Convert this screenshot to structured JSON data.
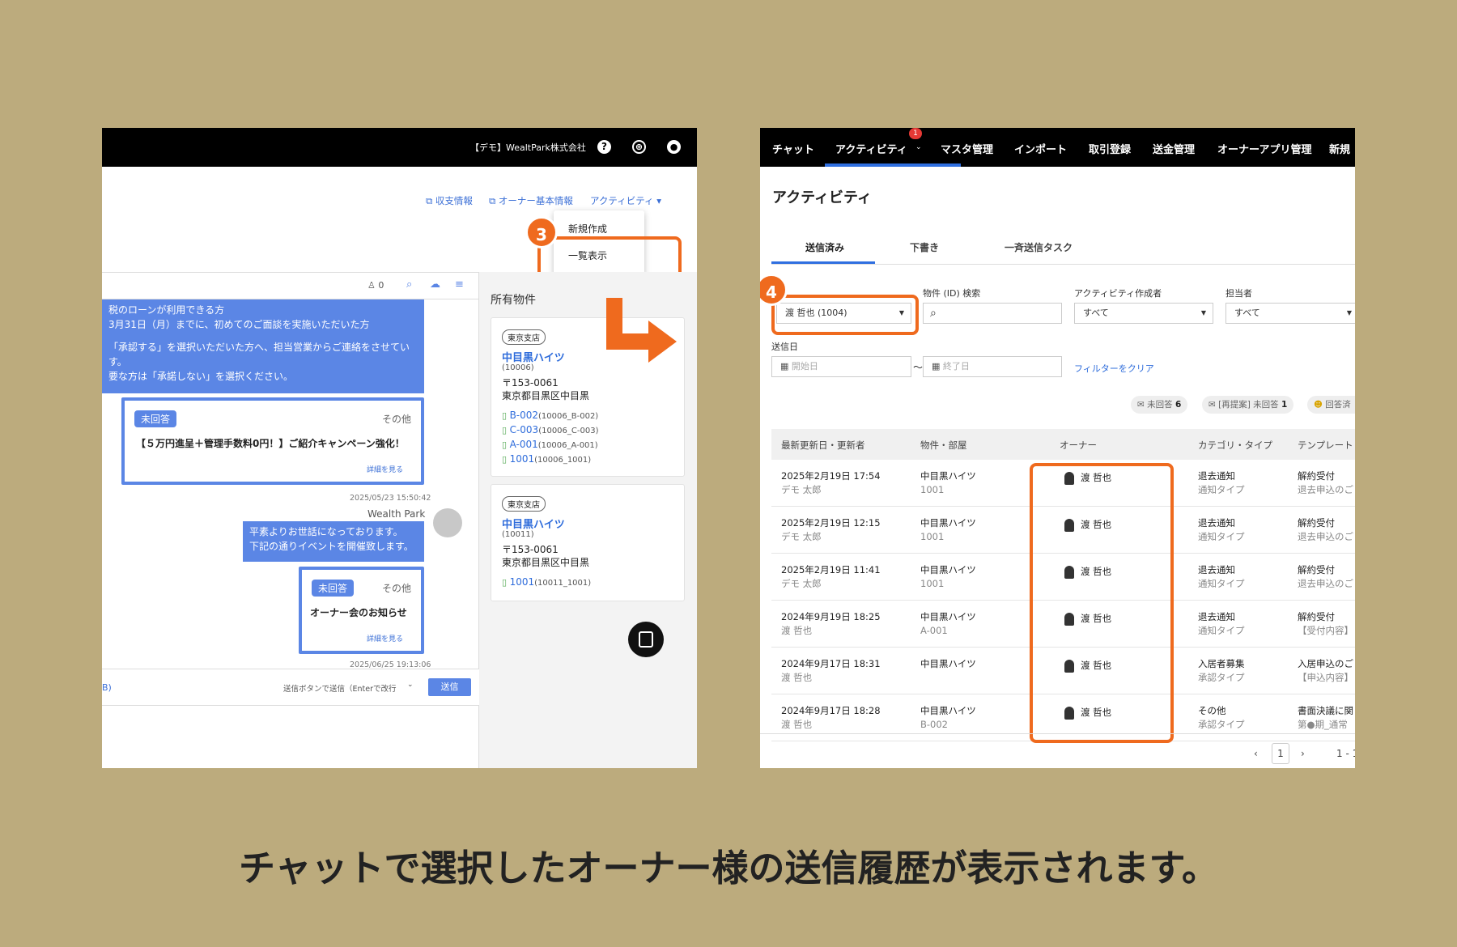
{
  "caption": "チャットで選択したオーナー様の送信履歴が表示されます。",
  "colors": {
    "accent_orange": "#ef6a1e",
    "chat_blue": "#5b86e5",
    "link_blue": "#2e6cdb",
    "background": "#bcab7d"
  },
  "left": {
    "company": "【デモ】WealtPark株式会社",
    "header_icons": [
      "help-icon",
      "globe-icon",
      "user-icon"
    ],
    "links": {
      "income": "収支情報",
      "owner_info": "オーナー基本情報",
      "activity": "アクティビティ ▾"
    },
    "menu": {
      "create": "新規作成",
      "list": "一覧表示"
    },
    "step_badge": "3",
    "chat_toolbar": {
      "count": "0"
    },
    "message1": [
      "税のローンが利用できる方",
      "3月31日（月）までに、初めてのご面談を実施いただいた方",
      "",
      "「承認する」を選択いただいた方へ、担当営業からご連絡をさせてい",
      "す。",
      "要な方は「承諾しない」を選択ください。"
    ],
    "card1": {
      "status": "未回答",
      "type": "その他",
      "title": "【５万円進呈＋管理手数料0円！】ご紹介キャンペーン強化！",
      "more": "詳細を見る"
    },
    "ts1": "2025/05/23 15:50:42",
    "sender": "Wealth Park",
    "message2": [
      "平素よりお世話になっております。",
      "下記の通りイベントを開催致します。"
    ],
    "card2": {
      "status": "未回答",
      "type": "その他",
      "title": "オーナー会のお知らせ",
      "more": "詳細を見る"
    },
    "ts2": "2025/06/25 19:13:06",
    "send_bar": {
      "left_text": "B)",
      "hint": "送信ボタンで送信（Enterで改行",
      "send": "送信"
    },
    "props_title": "所有物件",
    "properties": [
      {
        "branch": "東京支店",
        "name": "中目黒ハイツ",
        "id": "(10006)",
        "zip": "〒153-0061",
        "addr": "東京都目黒区中目黒",
        "rooms": [
          {
            "room": "B-002",
            "code": "(10006_B-002)"
          },
          {
            "room": "C-003",
            "code": "(10006_C-003)"
          },
          {
            "room": "A-001",
            "code": "(10006_A-001)"
          },
          {
            "room": "1001",
            "code": "(10006_1001)"
          }
        ]
      },
      {
        "branch": "東京支店",
        "name": "中目黒ハイツ",
        "id": "(10011)",
        "zip": "〒153-0061",
        "addr": "東京都目黒区中目黒",
        "rooms": [
          {
            "room": "1001",
            "code": "(10011_1001)"
          }
        ]
      }
    ]
  },
  "right": {
    "nav": [
      "チャット",
      "アクティビティ",
      "マスタ管理",
      "インポート",
      "取引登録",
      "送金管理",
      "オーナーアプリ管理",
      "新規"
    ],
    "nav_badge": "1",
    "page_title": "アクティビティ",
    "tabs": [
      "送信済み",
      "下書き",
      "一斉送信タスク"
    ],
    "step_badge": "4",
    "filters": {
      "owner_value": "渡 哲也 (1004)",
      "property_label": "物件 (ID) 検索",
      "creator_label": "アクティビティ作成者",
      "creator_value": "すべて",
      "assignee_label": "担当者",
      "assignee_value": "すべて",
      "date_label": "送信日",
      "start": "開始日",
      "end": "終了日",
      "tilde": "〜",
      "clear": "フィルターをクリア"
    },
    "chips": [
      {
        "label": "未回答",
        "count": "6"
      },
      {
        "label": "[再提案] 未回答",
        "count": "1"
      },
      {
        "label": "回答済",
        "count": ""
      }
    ],
    "headers": [
      "最新更新日・更新者",
      "物件・部屋",
      "オーナー",
      "カテゴリ・タイプ",
      "テンプレート"
    ],
    "rows": [
      {
        "date": "2025年2月19日 17:54",
        "by": "デモ 太郎",
        "prop": "中目黒ハイツ",
        "room": "1001",
        "owner": "渡 哲也",
        "cat": "退去通知",
        "type": "通知タイプ",
        "tpl": "解約受付",
        "tpl2": "退去申込のご"
      },
      {
        "date": "2025年2月19日 12:15",
        "by": "デモ 太郎",
        "prop": "中目黒ハイツ",
        "room": "1001",
        "owner": "渡 哲也",
        "cat": "退去通知",
        "type": "通知タイプ",
        "tpl": "解約受付",
        "tpl2": "退去申込のご"
      },
      {
        "date": "2025年2月19日 11:41",
        "by": "デモ 太郎",
        "prop": "中目黒ハイツ",
        "room": "1001",
        "owner": "渡 哲也",
        "cat": "退去通知",
        "type": "通知タイプ",
        "tpl": "解約受付",
        "tpl2": "退去申込のご"
      },
      {
        "date": "2024年9月19日 18:25",
        "by": "渡 哲也",
        "prop": "中目黒ハイツ",
        "room": "A-001",
        "owner": "渡 哲也",
        "cat": "退去通知",
        "type": "通知タイプ",
        "tpl": "解約受付",
        "tpl2": "【受付内容】"
      },
      {
        "date": "2024年9月17日 18:31",
        "by": "渡 哲也",
        "prop": "中目黒ハイツ",
        "room": "",
        "owner": "渡 哲也",
        "cat": "入居者募集",
        "type": "承認タイプ",
        "tpl": "入居申込のご",
        "tpl2": "【申込内容】"
      },
      {
        "date": "2024年9月17日 18:28",
        "by": "渡 哲也",
        "prop": "中目黒ハイツ",
        "room": "B-002",
        "owner": "渡 哲也",
        "cat": "その他",
        "type": "承認タイプ",
        "tpl": "書面決議に関",
        "tpl2": "第●期_通常"
      }
    ],
    "pager": {
      "prev": "‹",
      "page": "1",
      "next": "›",
      "range": "1 - 1"
    }
  }
}
